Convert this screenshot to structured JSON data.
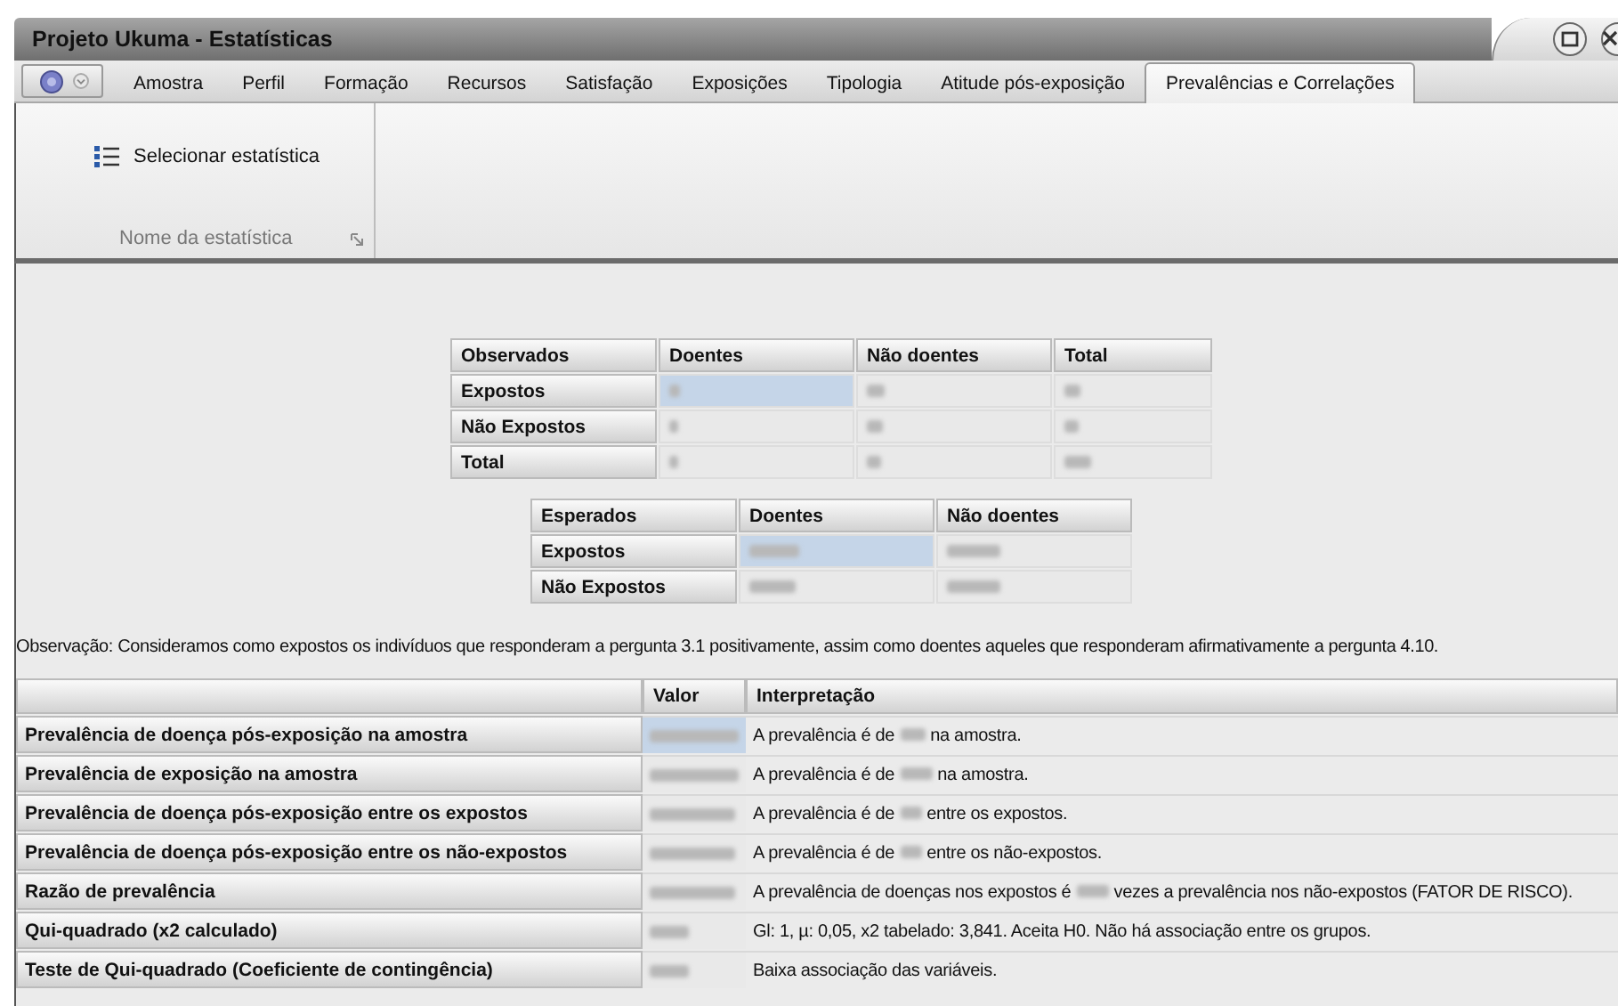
{
  "window": {
    "title": "Projeto Ukuma - Estatísticas"
  },
  "tabs": [
    {
      "label": "Amostra",
      "selected": false
    },
    {
      "label": "Perfil",
      "selected": false
    },
    {
      "label": "Formação",
      "selected": false
    },
    {
      "label": "Recursos",
      "selected": false
    },
    {
      "label": "Satisfação",
      "selected": false
    },
    {
      "label": "Exposições",
      "selected": false
    },
    {
      "label": "Tipologia",
      "selected": false
    },
    {
      "label": "Atitude pós-exposição",
      "selected": false
    },
    {
      "label": "Prevalências e Correlações",
      "selected": true
    }
  ],
  "ribbon": {
    "button": "Selecionar estatística",
    "group": "Nome da estatística"
  },
  "observed": {
    "columns": [
      "Observados",
      "Doentes",
      "Não doentes",
      "Total"
    ],
    "rows": [
      {
        "label": "Expostos",
        "cells": [
          {
            "selected": true
          },
          {
            "selected": false
          },
          {
            "selected": false
          }
        ]
      },
      {
        "label": "Não Expostos",
        "cells": [
          {
            "selected": false
          },
          {
            "selected": false
          },
          {
            "selected": false
          }
        ]
      },
      {
        "label": "Total",
        "cells": [
          {
            "selected": false
          },
          {
            "selected": false
          },
          {
            "selected": false
          }
        ]
      }
    ]
  },
  "expected": {
    "columns": [
      "Esperados",
      "Doentes",
      "Não doentes"
    ],
    "rows": [
      {
        "label": "Expostos",
        "cells": [
          {
            "selected": true
          },
          {
            "selected": false
          }
        ]
      },
      {
        "label": "Não Expostos",
        "cells": [
          {
            "selected": false
          },
          {
            "selected": false
          }
        ]
      }
    ]
  },
  "note": "Observação: Consideramos como expostos os indivíduos que responderam a pergunta 3.1 positivamente, assim como doentes aqueles que responderam afirmativamente a pergunta 4.10.",
  "stats": {
    "columns": [
      "Valor",
      "Interpretação"
    ],
    "rows": [
      {
        "label": "Prevalência de doença pós-exposição na amostra",
        "selected": true,
        "interpretation": [
          "A prevalência é de",
          "na amostra."
        ]
      },
      {
        "label": "Prevalência de exposição na amostra",
        "selected": false,
        "interpretation": [
          "A prevalência é de",
          "na amostra."
        ]
      },
      {
        "label": "Prevalência de doença pós-exposição entre os expostos",
        "selected": false,
        "interpretation": [
          "A prevalência é de",
          "entre os expostos."
        ]
      },
      {
        "label": "Prevalência de doença pós-exposição entre os não-expostos",
        "selected": false,
        "interpretation": [
          "A prevalência é de",
          "entre os não-expostos."
        ]
      },
      {
        "label": "Razão de prevalência",
        "selected": false,
        "interpretation": [
          "A prevalência de doenças nos expostos é",
          "vezes a prevalência nos não-expostos (FATOR DE RISCO)."
        ]
      },
      {
        "label": "Qui-quadrado (x2 calculado)",
        "selected": false,
        "interpretation": [
          "Gl: 1, µ: 0,05, x2 tabelado: 3,841. Aceita H0. Não há associação entre os grupos."
        ]
      },
      {
        "label": "Teste de Qui-quadrado (Coeficiente de contingência)",
        "selected": false,
        "interpretation": [
          "Baixa associação das variáveis."
        ]
      }
    ]
  }
}
